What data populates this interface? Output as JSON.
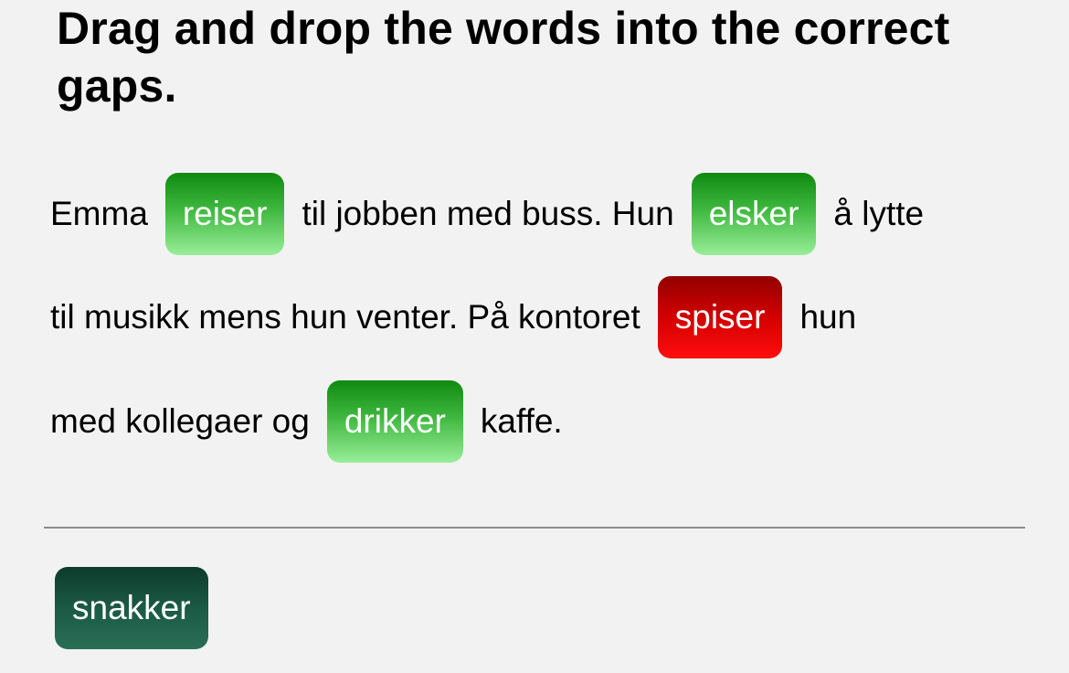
{
  "title": "Drag and drop the words into the correct gaps.",
  "exercise": {
    "line1": {
      "t1": "Emma",
      "gap1": "reiser",
      "t2": "til jobben med buss. Hun",
      "gap2": "elsker",
      "t3": "å lytte"
    },
    "line2": {
      "t1": "til musikk mens hun venter. På kontoret",
      "gap3": "spiser",
      "t2": "hun"
    },
    "line3": {
      "t1": "med kollegaer og",
      "gap4": "drikker",
      "t2": "kaffe."
    }
  },
  "word_bank": [
    "snakker"
  ],
  "colors": {
    "correct": "#3fb83f",
    "wrong": "#d20000",
    "bank": "#1b5a45",
    "background": "#f2f2f2"
  }
}
